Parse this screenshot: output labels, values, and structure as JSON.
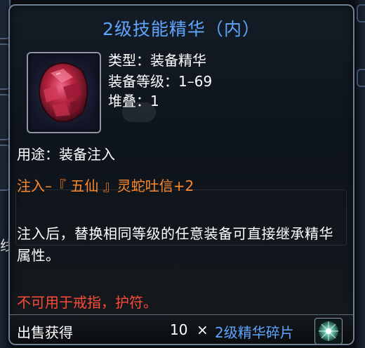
{
  "tooltip": {
    "title": "2级技能精华（内）",
    "item_icon": "red-gem-icon",
    "stats": [
      {
        "label": "类型：",
        "value": "装备精华"
      },
      {
        "label": "装备等级：",
        "value": "1–69"
      },
      {
        "label": "堆叠：",
        "value": "1"
      }
    ],
    "purpose": "用途：装备注入",
    "inject_effect": "注入–『 五仙 』灵蛇吐信+2",
    "description": "注入后，替换相同等级的任意装备可直接继承精华属性。",
    "restriction": "不可用于戒指，护符。",
    "sell": {
      "label": "出售获得",
      "quantity": "10",
      "times": "×",
      "item_name": "2级精华碎片",
      "item_icon": "essence-shard-icon"
    }
  },
  "background": {
    "edge_char": "线"
  },
  "colors": {
    "title_blue": "#5fa4ff",
    "inject_orange": "#ff8a2b",
    "restriction_red": "#ff4a36",
    "text_white": "#ffffff"
  }
}
